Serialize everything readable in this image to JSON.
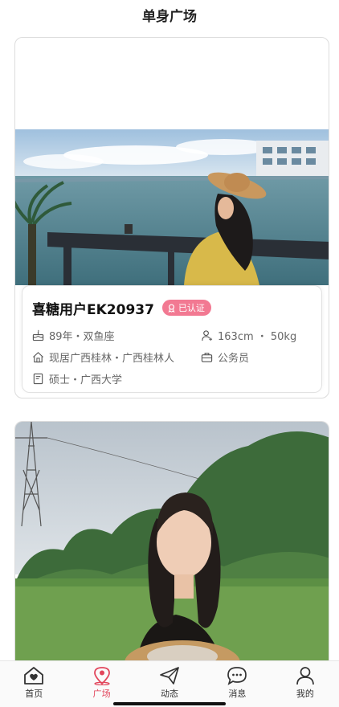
{
  "page": {
    "title": "单身广场"
  },
  "cards": [
    {
      "name": "喜糖用户EK20937",
      "verified_label": "已认证",
      "birth": "89年・双鱼座",
      "body": "163cm ・ 50kg",
      "residence": "现居广西桂林・广西桂林人",
      "job": "公务员",
      "education": "硕士・广西大学"
    }
  ],
  "tabbar": {
    "items": [
      {
        "label": "首页",
        "icon": "home-heart-icon",
        "active": false
      },
      {
        "label": "广场",
        "icon": "location-pin-icon",
        "active": true
      },
      {
        "label": "动态",
        "icon": "paper-plane-icon",
        "active": false
      },
      {
        "label": "消息",
        "icon": "chat-bubble-icon",
        "active": false
      },
      {
        "label": "我的",
        "icon": "person-icon",
        "active": false
      }
    ]
  },
  "colors": {
    "accent": "#e2455b",
    "badge": "#f27992"
  }
}
